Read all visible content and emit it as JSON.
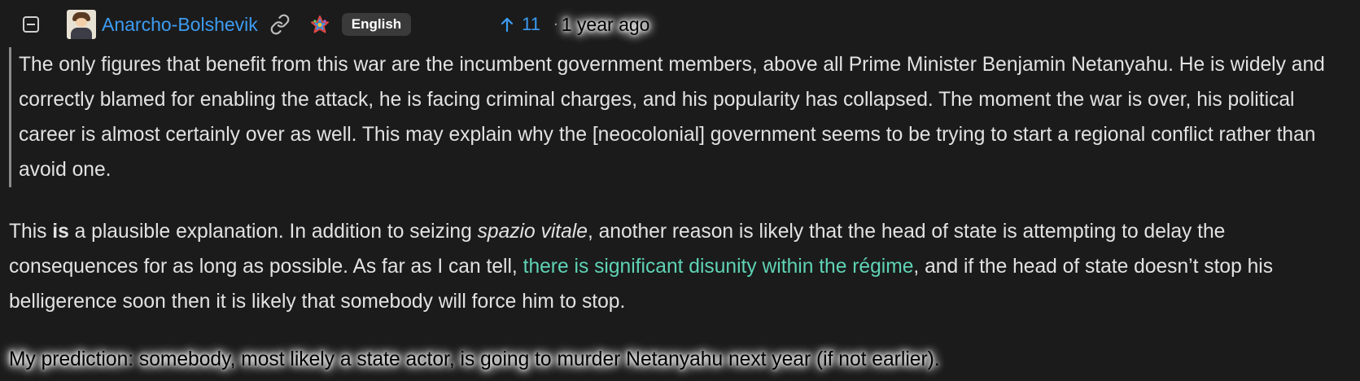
{
  "comment": {
    "collapse_icon": "collapse-minus-icon",
    "avatar_icon": "user-avatar",
    "username": "Anarcho-Bolshevik",
    "link_icon": "link-icon",
    "federation_icon": "federation-star-icon",
    "language": "English",
    "score_icon": "upvote-arrow-icon",
    "score": "11",
    "separator": "·",
    "timestamp": "1 year ago"
  },
  "body": {
    "quote": "The only figures that benefit from this war are the incumbent government members, above all Prime Minister Benjamin Netanyahu. He is widely and correctly blamed for enabling the attack, he is facing criminal charges, and his popularity has collapsed. The moment the war is over, his political career is almost certainly over as well. This may explain why the [neocolonial] government seems to be trying to start a regional conflict rather than avoid one.",
    "p2": {
      "t1": "This ",
      "bold": "is",
      "t2": " a plausible explanation. In addition to seizing ",
      "italic": "spazio vitale",
      "t3": ", another reason is likely that the head of state is attempting to delay the consequences for as long as possible. As far as I can tell, ",
      "link": "there is significant disunity within the régime",
      "t4": ", and if the head of state doesn’t stop his belligerence soon then it is likely that somebody will force him to stop."
    },
    "p3": "My prediction: somebody, most likely a state actor, is going to murder Netanyahu next year (if not earlier)."
  },
  "colors": {
    "background": "#1b1b1b",
    "text": "#dedede",
    "username": "#3c9cf3",
    "score": "#3c9cf3",
    "link": "#5fd3b5",
    "badge_bg": "#3a3a3a",
    "quote_border": "#8b8b8b"
  }
}
